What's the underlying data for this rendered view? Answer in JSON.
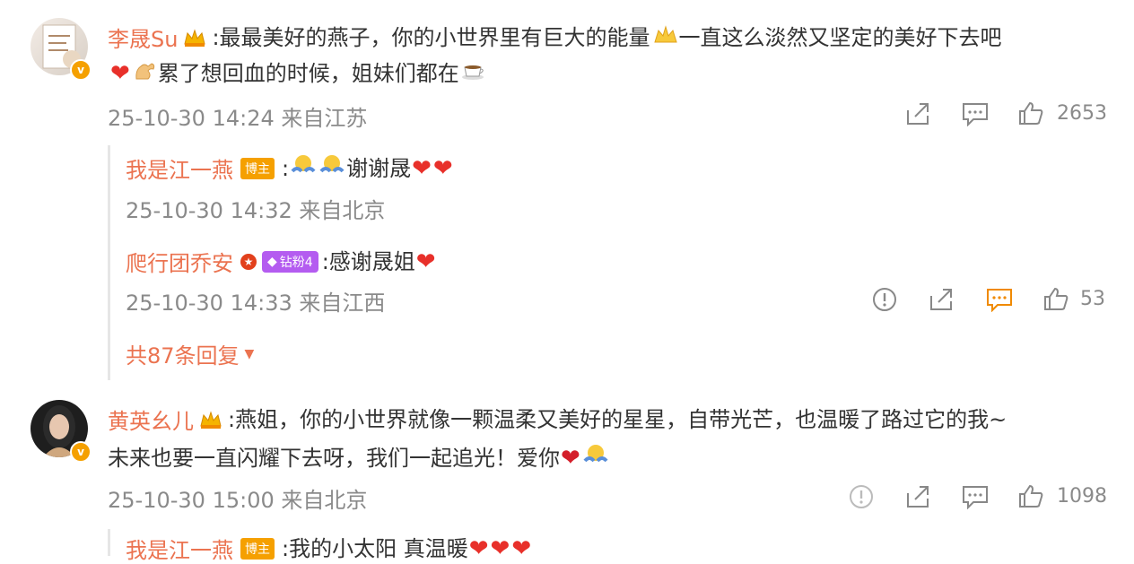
{
  "comments": [
    {
      "name": "李晟Su",
      "text_line1": "最最美好的燕子，你的小世界里有巨大的能量",
      "text_line1b": "一直这么淡然又坚定的美好下去吧",
      "text_line2": "累了想回血的时候，姐妹们都在",
      "meta": "25-10-30 14:24 来自江苏",
      "likes": "2653",
      "replies": [
        {
          "name": "我是江一燕",
          "badge": "博主",
          "text": "谢谢晟",
          "meta": "25-10-30 14:32 来自北京"
        },
        {
          "name": "爬行团乔安",
          "badge": "钻粉4",
          "text": "感谢晟姐",
          "meta": "25-10-30 14:33 来自江西",
          "likes": "53"
        }
      ],
      "more_replies": "共87条回复"
    },
    {
      "name": "黄英幺儿",
      "text_line1": "燕姐，你的小世界就像一颗温柔又美好的星星，自带光芒，也温暖了路过它的我~",
      "text_line2": "未来也要一直闪耀下去呀，我们一起追光！爱你",
      "meta": "25-10-30 15:00 来自北京",
      "likes": "1098",
      "replies": [
        {
          "name": "我是江一燕",
          "badge": "博主",
          "text": "我的小太阳 真温暖"
        }
      ]
    }
  ],
  "colors": {
    "name": "#eb7350",
    "meta": "#8a8a8a",
    "heart": "#e8302a",
    "badge_boss": "#f5a000",
    "badge_fan": "#b45cf0"
  }
}
